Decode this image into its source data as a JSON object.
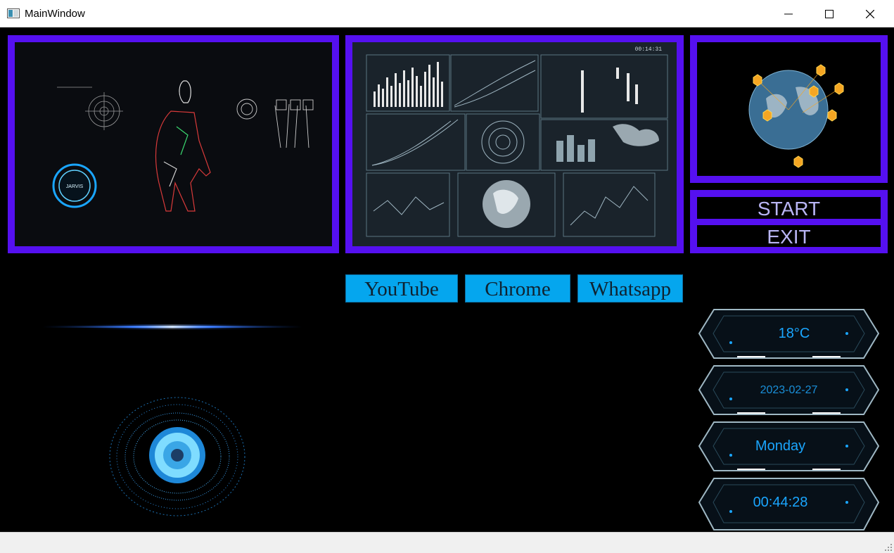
{
  "window": {
    "title": "MainWindow",
    "minimize_icon": "minimize-icon",
    "maximize_icon": "maximize-icon",
    "close_icon": "close-icon"
  },
  "controls": {
    "start_label": "START",
    "exit_label": "EXIT"
  },
  "apps": {
    "youtube_label": "YouTube",
    "chrome_label": "Chrome",
    "whatsapp_label": "Whatsapp"
  },
  "hud": {
    "temperature": "18°C",
    "date": "2023-02-27",
    "day": "Monday",
    "time": "00:44:28"
  },
  "panels": {
    "dashboard_clock": "00:14:31",
    "jarvis_badge": "JARVIS"
  },
  "colors": {
    "frame": "#5510f0",
    "app_button": "#05a6ee",
    "hud_text": "#1aa6ff"
  }
}
